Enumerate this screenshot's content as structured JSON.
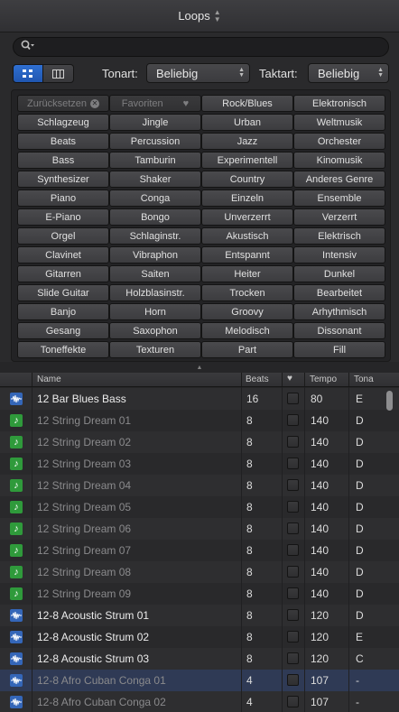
{
  "window": {
    "title": "Loops"
  },
  "search": {
    "value": "",
    "placeholder": ""
  },
  "filters": {
    "scale_label": "Tonart:",
    "scale_value": "Beliebig",
    "signature_label": "Taktart:",
    "signature_value": "Beliebig"
  },
  "keywords": [
    "Zurücksetzen",
    "Favoriten",
    "Rock/Blues",
    "Elektronisch",
    "Schlagzeug",
    "Jingle",
    "Urban",
    "Weltmusik",
    "Beats",
    "Percussion",
    "Jazz",
    "Orchester",
    "Bass",
    "Tamburin",
    "Experimentell",
    "Kinomusik",
    "Synthesizer",
    "Shaker",
    "Country",
    "Anderes Genre",
    "Piano",
    "Conga",
    "Einzeln",
    "Ensemble",
    "E-Piano",
    "Bongo",
    "Unverzerrt",
    "Verzerrt",
    "Orgel",
    "Schlaginstr.",
    "Akustisch",
    "Elektrisch",
    "Clavinet",
    "Vibraphon",
    "Entspannt",
    "Intensiv",
    "Gitarren",
    "Saiten",
    "Heiter",
    "Dunkel",
    "Slide Guitar",
    "Holzblasinstr.",
    "Trocken",
    "Bearbeitet",
    "Banjo",
    "Horn",
    "Groovy",
    "Arhythmisch",
    "Gesang",
    "Saxophon",
    "Melodisch",
    "Dissonant",
    "Toneffekte",
    "Texturen",
    "Part",
    "Fill"
  ],
  "table": {
    "columns": {
      "name": "Name",
      "beats": "Beats",
      "tempo": "Tempo",
      "key": "Tona"
    },
    "rows": [
      {
        "type": "audio",
        "name": "12 Bar Blues Bass",
        "beats": "16",
        "tempo": "80",
        "key": "E",
        "dim": false
      },
      {
        "type": "midi",
        "name": "12 String Dream 01",
        "beats": "8",
        "tempo": "140",
        "key": "D",
        "dim": true
      },
      {
        "type": "midi",
        "name": "12 String Dream 02",
        "beats": "8",
        "tempo": "140",
        "key": "D",
        "dim": true
      },
      {
        "type": "midi",
        "name": "12 String Dream 03",
        "beats": "8",
        "tempo": "140",
        "key": "D",
        "dim": true
      },
      {
        "type": "midi",
        "name": "12 String Dream 04",
        "beats": "8",
        "tempo": "140",
        "key": "D",
        "dim": true
      },
      {
        "type": "midi",
        "name": "12 String Dream 05",
        "beats": "8",
        "tempo": "140",
        "key": "D",
        "dim": true
      },
      {
        "type": "midi",
        "name": "12 String Dream 06",
        "beats": "8",
        "tempo": "140",
        "key": "D",
        "dim": true
      },
      {
        "type": "midi",
        "name": "12 String Dream 07",
        "beats": "8",
        "tempo": "140",
        "key": "D",
        "dim": true
      },
      {
        "type": "midi",
        "name": "12 String Dream 08",
        "beats": "8",
        "tempo": "140",
        "key": "D",
        "dim": true
      },
      {
        "type": "midi",
        "name": "12 String Dream 09",
        "beats": "8",
        "tempo": "140",
        "key": "D",
        "dim": true
      },
      {
        "type": "audio",
        "name": "12-8 Acoustic Strum 01",
        "beats": "8",
        "tempo": "120",
        "key": "D",
        "dim": false
      },
      {
        "type": "audio",
        "name": "12-8 Acoustic Strum 02",
        "beats": "8",
        "tempo": "120",
        "key": "E",
        "dim": false
      },
      {
        "type": "audio",
        "name": "12-8 Acoustic Strum 03",
        "beats": "8",
        "tempo": "120",
        "key": "C",
        "dim": false
      },
      {
        "type": "audio",
        "name": "12-8 Afro Cuban Conga 01",
        "beats": "4",
        "tempo": "107",
        "key": "-",
        "dim": true,
        "selected": true
      },
      {
        "type": "audio",
        "name": "12-8 Afro Cuban Conga 02",
        "beats": "4",
        "tempo": "107",
        "key": "-",
        "dim": true
      }
    ]
  }
}
